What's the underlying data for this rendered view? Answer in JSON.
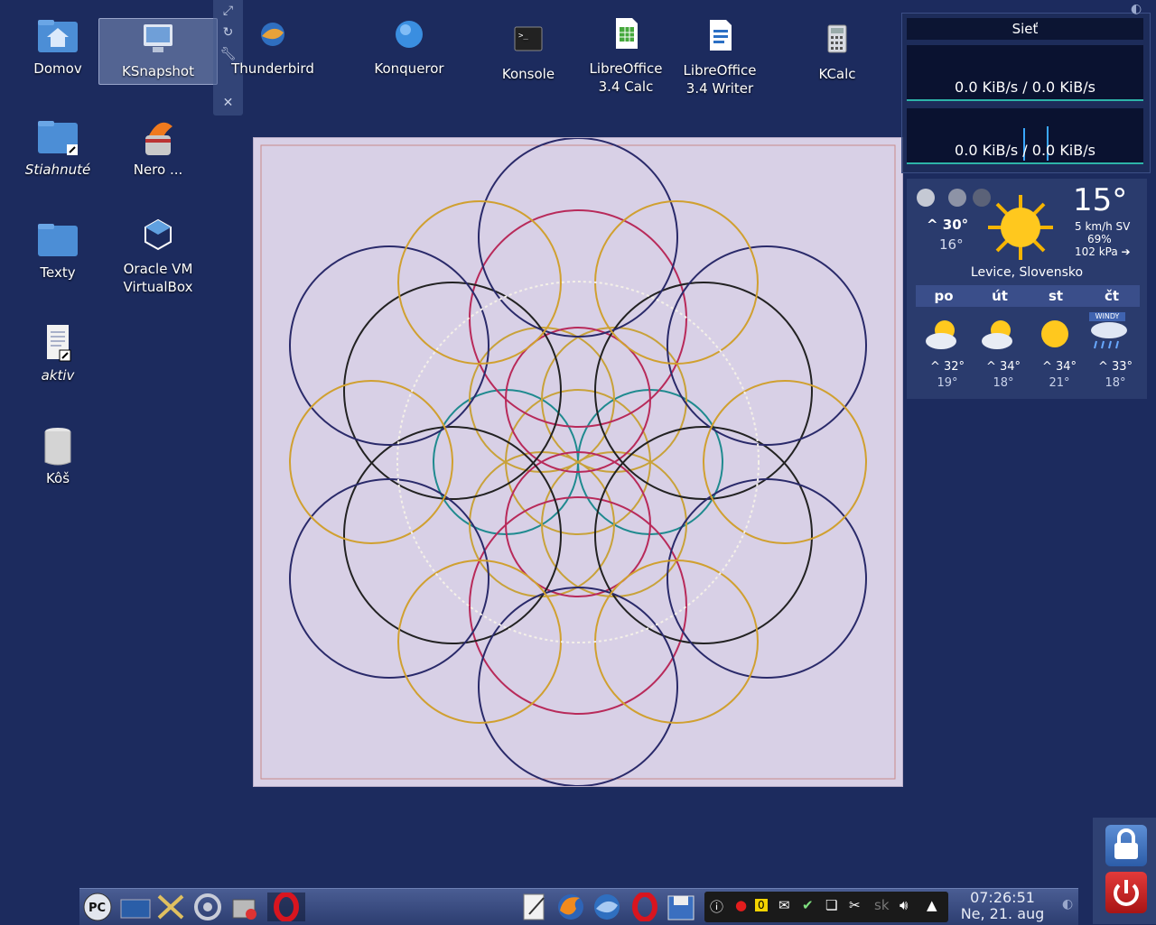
{
  "desktop_icons": [
    {
      "id": "domov",
      "label": "Domov"
    },
    {
      "id": "ksnapshot",
      "label": "KSnapshot"
    },
    {
      "id": "thunderbird",
      "label": "Thunderbird"
    },
    {
      "id": "konqueror",
      "label": "Konqueror"
    },
    {
      "id": "konsole",
      "label": "Konsole"
    },
    {
      "id": "lo-calc",
      "label": "LibreOffice\n3.4 Calc"
    },
    {
      "id": "lo-writer",
      "label": "LibreOffice\n3.4 Writer"
    },
    {
      "id": "kcalc",
      "label": "KCalc"
    },
    {
      "id": "stiahnute",
      "label": "Stiahnuté"
    },
    {
      "id": "nero",
      "label": "Nero ..."
    },
    {
      "id": "texty",
      "label": "Texty"
    },
    {
      "id": "virtualbox",
      "label": "Oracle VM\nVirtualBox"
    },
    {
      "id": "aktiv",
      "label": "aktiv"
    },
    {
      "id": "kos",
      "label": "Kôš"
    }
  ],
  "network": {
    "title": "Sieť",
    "rate1": "0.0 KiB/s / 0.0 KiB/s",
    "rate2": "0.0 KiB/s / 0.0 KiB/s"
  },
  "weather": {
    "temp": "15°",
    "high": "^ 30°",
    "low": "16°",
    "wind": "5 km/h SV",
    "humidity": "69%",
    "pressure": "102 kPa ➔",
    "location": "Levice, Slovensko",
    "forecast": [
      {
        "day": "po",
        "high": "^ 32°",
        "low": "19°"
      },
      {
        "day": "út",
        "high": "^ 34°",
        "low": "18°"
      },
      {
        "day": "st",
        "high": "^ 34°",
        "low": "21°"
      },
      {
        "day": "čt",
        "high": "^ 33°",
        "low": "18°"
      }
    ],
    "windy_label": "WINDY"
  },
  "taskbar": {
    "launcher": "PC",
    "tray_sk": "sk",
    "tray_zero": "0"
  },
  "clock": {
    "time": "07:26:51",
    "date": "Ne, 21. aug"
  }
}
